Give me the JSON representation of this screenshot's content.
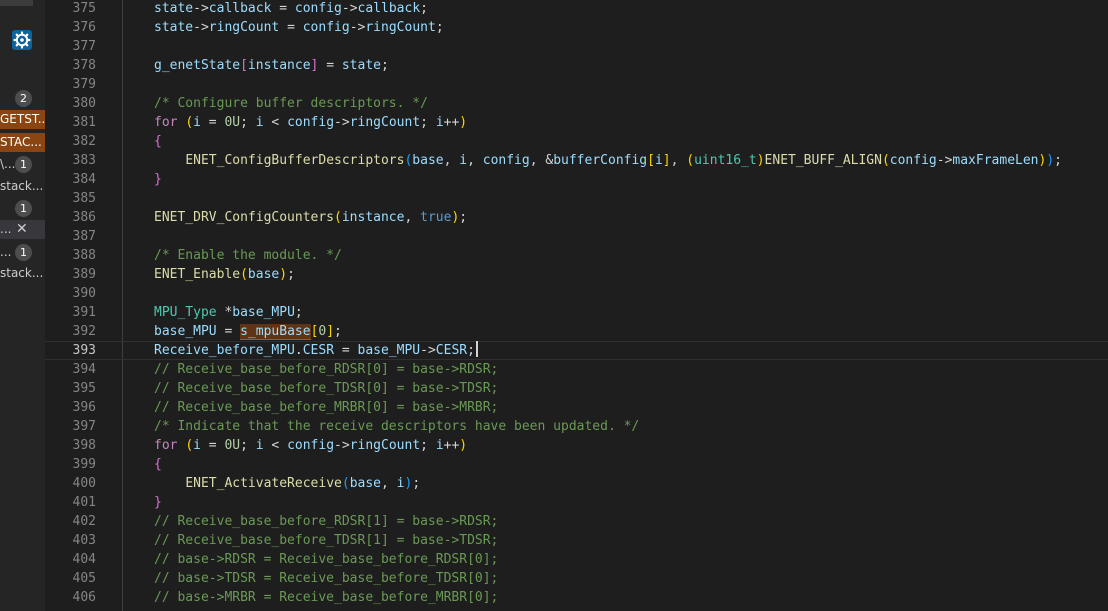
{
  "colors": {
    "background": "#1e1e1e",
    "line_number": "#858585",
    "comment": "#6a9955",
    "keyword": "#c586c0",
    "function": "#dcdcaa",
    "variable": "#9cdcfe",
    "type": "#4ec9b0",
    "number": "#b5cea8",
    "constant": "#569cd6",
    "bracket_gold": "#ffd700",
    "bracket_purple": "#da70d6",
    "bracket_blue": "#179fff",
    "text": "#d4d4d4"
  },
  "sidebar": {
    "rows": [
      {
        "kind": "badge",
        "count": "2"
      },
      {
        "kind": "highlighted",
        "text": "GETST..."
      },
      {
        "kind": "highlighted",
        "text": "STAC..."
      },
      {
        "kind": "item-badge",
        "text": "\\...",
        "count": "1"
      },
      {
        "kind": "text",
        "text": "stack..."
      },
      {
        "kind": "badge",
        "count": "1"
      },
      {
        "kind": "selected-close",
        "text": "..."
      },
      {
        "kind": "item-badge",
        "text": "...",
        "count": "1"
      },
      {
        "kind": "text",
        "text": "stack..."
      }
    ]
  },
  "editor": {
    "current_line": 393,
    "lines": [
      {
        "n": "375",
        "tokens": [
          [
            "state",
            "v"
          ],
          [
            "->",
            ""
          ],
          [
            "callback",
            "v"
          ],
          [
            " = ",
            ""
          ],
          [
            "config",
            "v"
          ],
          [
            "->",
            ""
          ],
          [
            "callback",
            "v"
          ],
          [
            ";",
            ""
          ]
        ]
      },
      {
        "n": "376",
        "tokens": [
          [
            "state",
            "v"
          ],
          [
            "->",
            ""
          ],
          [
            "ringCount",
            "v"
          ],
          [
            " = ",
            ""
          ],
          [
            "config",
            "v"
          ],
          [
            "->",
            ""
          ],
          [
            "ringCount",
            "v"
          ],
          [
            ";",
            ""
          ]
        ]
      },
      {
        "n": "377",
        "tokens": []
      },
      {
        "n": "378",
        "tokens": [
          [
            "g_enetState",
            "v"
          ],
          [
            "[",
            "bp"
          ],
          [
            "instance",
            "v"
          ],
          [
            "]",
            "bp"
          ],
          [
            " = ",
            ""
          ],
          [
            "state",
            "v"
          ],
          [
            ";",
            ""
          ]
        ]
      },
      {
        "n": "379",
        "tokens": []
      },
      {
        "n": "380",
        "tokens": [
          [
            "/* Configure buffer descriptors. */",
            "c"
          ]
        ]
      },
      {
        "n": "381",
        "tokens": [
          [
            "for",
            "k"
          ],
          [
            " ",
            ""
          ],
          [
            "(",
            "bg"
          ],
          [
            "i",
            "v"
          ],
          [
            " = ",
            ""
          ],
          [
            "0U",
            "n"
          ],
          [
            "; ",
            ""
          ],
          [
            "i",
            "v"
          ],
          [
            " < ",
            ""
          ],
          [
            "config",
            "v"
          ],
          [
            "->",
            ""
          ],
          [
            "ringCount",
            "v"
          ],
          [
            "; ",
            ""
          ],
          [
            "i",
            "v"
          ],
          [
            "++",
            ""
          ],
          [
            ")",
            "bg"
          ]
        ]
      },
      {
        "n": "382",
        "tokens": [
          [
            "{",
            "bp"
          ]
        ]
      },
      {
        "n": "383",
        "tokens": [
          [
            "    ",
            ""
          ],
          [
            "ENET_ConfigBufferDescriptors",
            "f"
          ],
          [
            "(",
            "bb"
          ],
          [
            "base",
            "v"
          ],
          [
            ", ",
            ""
          ],
          [
            "i",
            "v"
          ],
          [
            ", ",
            ""
          ],
          [
            "config",
            "v"
          ],
          [
            ", &",
            ""
          ],
          [
            "bufferConfig",
            "v"
          ],
          [
            "[",
            "bg"
          ],
          [
            "i",
            "v"
          ],
          [
            "]",
            "bg"
          ],
          [
            ", ",
            ""
          ],
          [
            "(",
            "bg"
          ],
          [
            "uint16_t",
            "t"
          ],
          [
            ")",
            "bg"
          ],
          [
            "ENET_BUFF_ALIGN",
            "f"
          ],
          [
            "(",
            "bg"
          ],
          [
            "config",
            "v"
          ],
          [
            "->",
            ""
          ],
          [
            "maxFrameLen",
            "v"
          ],
          [
            ")",
            "bg"
          ],
          [
            ")",
            "bb"
          ],
          [
            ";",
            ""
          ]
        ]
      },
      {
        "n": "384",
        "tokens": [
          [
            "}",
            "bp"
          ]
        ]
      },
      {
        "n": "385",
        "tokens": []
      },
      {
        "n": "386",
        "tokens": [
          [
            "ENET_DRV_ConfigCounters",
            "f"
          ],
          [
            "(",
            "bg"
          ],
          [
            "instance",
            "v"
          ],
          [
            ", ",
            ""
          ],
          [
            "true",
            "const"
          ],
          [
            ")",
            "bg"
          ],
          [
            ";",
            ""
          ]
        ]
      },
      {
        "n": "387",
        "tokens": []
      },
      {
        "n": "388",
        "tokens": [
          [
            "/* Enable the module. */",
            "c"
          ]
        ]
      },
      {
        "n": "389",
        "tokens": [
          [
            "ENET_Enable",
            "f"
          ],
          [
            "(",
            "bg"
          ],
          [
            "base",
            "v"
          ],
          [
            ")",
            "bg"
          ],
          [
            ";",
            ""
          ]
        ]
      },
      {
        "n": "390",
        "tokens": []
      },
      {
        "n": "391",
        "tokens": [
          [
            "MPU_Type",
            "t"
          ],
          [
            " *",
            ""
          ],
          [
            "base_MPU",
            "v"
          ],
          [
            ";",
            ""
          ]
        ]
      },
      {
        "n": "392",
        "tokens": [
          [
            "base_MPU",
            "v"
          ],
          [
            " = ",
            ""
          ],
          [
            "s_mpuBase",
            "hv"
          ],
          [
            "[",
            "bg"
          ],
          [
            "0",
            "n"
          ],
          [
            "]",
            "bg"
          ],
          [
            ";",
            ""
          ]
        ]
      },
      {
        "n": "393",
        "tokens": [
          [
            "Receive_before_MPU",
            "v"
          ],
          [
            ".",
            ""
          ],
          [
            "CESR",
            "v"
          ],
          [
            " = ",
            ""
          ],
          [
            "base_MPU",
            "v"
          ],
          [
            "->",
            ""
          ],
          [
            "CESR",
            "v"
          ],
          [
            ";",
            "cur"
          ]
        ]
      },
      {
        "n": "394",
        "tokens": [
          [
            "// Receive_base_before_RDSR[0] = base->RDSR;",
            "c"
          ]
        ]
      },
      {
        "n": "395",
        "tokens": [
          [
            "// Receive_base_before_TDSR[0] = base->TDSR;",
            "c"
          ]
        ]
      },
      {
        "n": "396",
        "tokens": [
          [
            "// Receive_base_before_MRBR[0] = base->MRBR;",
            "c"
          ]
        ]
      },
      {
        "n": "397",
        "tokens": [
          [
            "/* Indicate that the receive descriptors have been updated. */",
            "c"
          ]
        ]
      },
      {
        "n": "398",
        "tokens": [
          [
            "for",
            "k"
          ],
          [
            " ",
            ""
          ],
          [
            "(",
            "bg"
          ],
          [
            "i",
            "v"
          ],
          [
            " = ",
            ""
          ],
          [
            "0U",
            "n"
          ],
          [
            "; ",
            ""
          ],
          [
            "i",
            "v"
          ],
          [
            " < ",
            ""
          ],
          [
            "config",
            "v"
          ],
          [
            "->",
            ""
          ],
          [
            "ringCount",
            "v"
          ],
          [
            "; ",
            ""
          ],
          [
            "i",
            "v"
          ],
          [
            "++",
            ""
          ],
          [
            ")",
            "bg"
          ]
        ]
      },
      {
        "n": "399",
        "tokens": [
          [
            "{",
            "bp"
          ]
        ]
      },
      {
        "n": "400",
        "tokens": [
          [
            "    ",
            ""
          ],
          [
            "ENET_ActivateReceive",
            "f"
          ],
          [
            "(",
            "bb"
          ],
          [
            "base",
            "v"
          ],
          [
            ", ",
            ""
          ],
          [
            "i",
            "v"
          ],
          [
            ")",
            "bb"
          ],
          [
            ";",
            ""
          ]
        ]
      },
      {
        "n": "401",
        "tokens": [
          [
            "}",
            "bp"
          ]
        ]
      },
      {
        "n": "402",
        "tokens": [
          [
            "// Receive_base_before_RDSR[1] = base->RDSR;",
            "c"
          ]
        ]
      },
      {
        "n": "403",
        "tokens": [
          [
            "// Receive_base_before_TDSR[1] = base->TDSR;",
            "c"
          ]
        ]
      },
      {
        "n": "404",
        "tokens": [
          [
            "// base->RDSR = Receive_base_before_RDSR[0];",
            "c"
          ]
        ]
      },
      {
        "n": "405",
        "tokens": [
          [
            "// base->TDSR = Receive_base_before_TDSR[0];",
            "c"
          ]
        ]
      },
      {
        "n": "406",
        "tokens": [
          [
            "// base->MRBR = Receive_base_before_MRBR[0];",
            "c"
          ]
        ]
      }
    ]
  }
}
